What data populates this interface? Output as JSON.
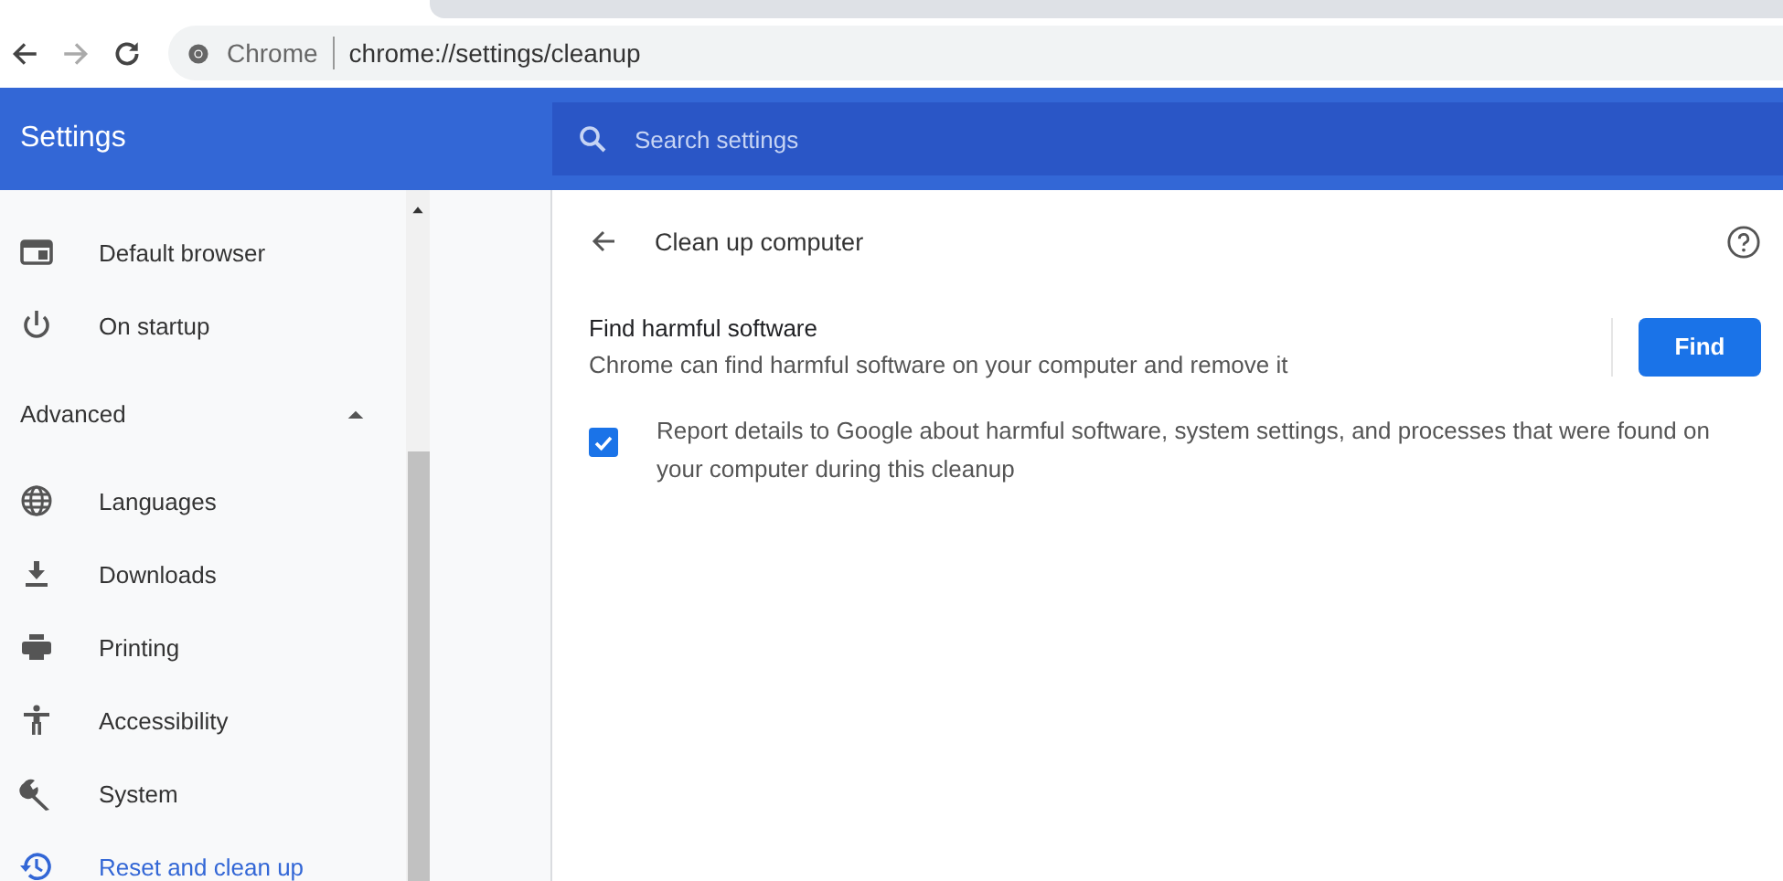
{
  "browser": {
    "origin_label": "Chrome",
    "url": "chrome://settings/cleanup"
  },
  "header": {
    "title": "Settings",
    "search": {
      "placeholder": "Search settings"
    }
  },
  "sidebar": {
    "items": [
      {
        "label": "Default browser",
        "selected": false
      },
      {
        "label": "On startup",
        "selected": false
      }
    ],
    "advanced": {
      "label": "Advanced",
      "expanded": true,
      "items": [
        {
          "label": "Languages",
          "selected": false
        },
        {
          "label": "Downloads",
          "selected": false
        },
        {
          "label": "Printing",
          "selected": false
        },
        {
          "label": "Accessibility",
          "selected": false
        },
        {
          "label": "System",
          "selected": false
        },
        {
          "label": "Reset and clean up",
          "selected": true
        }
      ]
    }
  },
  "page": {
    "title": "Clean up computer",
    "section": {
      "title": "Find harmful software",
      "description": "Chrome can find harmful software on your computer and remove it",
      "button": "Find"
    },
    "report": {
      "text": "Report details to Google about harmful software, system settings, and processes that were found on your computer during this cleanup",
      "checked": true
    }
  }
}
